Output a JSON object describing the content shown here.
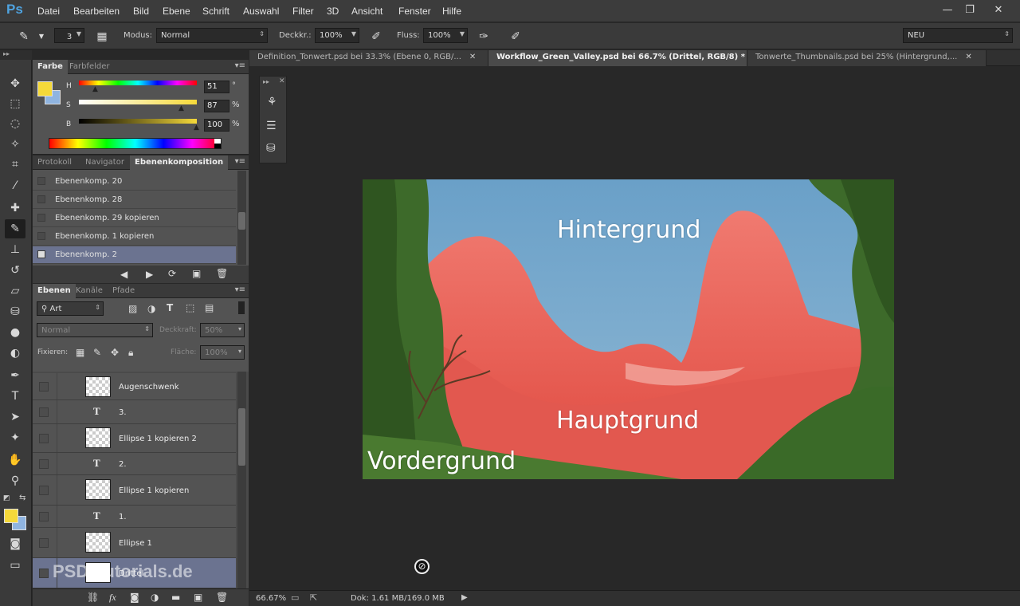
{
  "app": {
    "logo": "Ps"
  },
  "menu": [
    "Datei",
    "Bearbeiten",
    "Bild",
    "Ebene",
    "Schrift",
    "Auswahl",
    "Filter",
    "3D",
    "Ansicht",
    "Fenster",
    "Hilfe"
  ],
  "window_controls": {
    "minimize": "—",
    "restore": "❐",
    "close": "✕"
  },
  "options": {
    "brush_size": "3",
    "mode_label": "Modus:",
    "mode_value": "Normal",
    "opacity_label": "Deckkr.:",
    "opacity_value": "100%",
    "flow_label": "Fluss:",
    "flow_value": "100%",
    "workspace": "NEU"
  },
  "color_panel": {
    "tabs": [
      "Farbe",
      "Farbfelder"
    ],
    "h_label": "H",
    "h_value": "51",
    "h_unit": "°",
    "s_label": "S",
    "s_value": "87",
    "s_unit": "%",
    "b_label": "B",
    "b_value": "100",
    "b_unit": "%",
    "foreground": "#f5d93a",
    "background": "#8fb4e0"
  },
  "comp_panel": {
    "tabs": [
      "Protokoll",
      "Navigator",
      "Ebenenkomposition"
    ],
    "items": [
      "Ebenenkomp. 20",
      "Ebenenkomp. 28",
      "Ebenenkomp. 29 kopieren",
      "Ebenenkomp. 1 kopieren",
      "Ebenenkomp. 2"
    ],
    "selected": 4
  },
  "layers_panel": {
    "tabs": [
      "Ebenen",
      "Kanäle",
      "Pfade"
    ],
    "filter_label": "Art",
    "blend_mode": "Normal",
    "opacity_label": "Deckkraft:",
    "opacity_value": "50%",
    "lock_label": "Fixieren:",
    "fill_label": "Fläche:",
    "fill_value": "100%",
    "layers": [
      {
        "name": "Augenschwenk",
        "kind": "pixel"
      },
      {
        "name": "3.",
        "kind": "text"
      },
      {
        "name": "Ellipse 1 kopieren 2",
        "kind": "shape"
      },
      {
        "name": "2.",
        "kind": "text"
      },
      {
        "name": "Ellipse 1 kopieren",
        "kind": "shape"
      },
      {
        "name": "1.",
        "kind": "text"
      },
      {
        "name": "Ellipse 1",
        "kind": "shape"
      },
      {
        "name": "Drittel",
        "kind": "shape"
      }
    ]
  },
  "doc_tabs": [
    {
      "title": "Definition_Tonwert.psd bei 33.3% (Ebene 0, RGB/...",
      "close": "✕"
    },
    {
      "title": "Workflow_Green_Valley.psd bei 66.7% (Drittel, RGB/8) *",
      "close": "✕"
    },
    {
      "title": "Tonwerte_Thumbnails.psd bei 25% (Hintergrund,...",
      "close": "✕"
    }
  ],
  "artwork_labels": {
    "top": "Hintergrund",
    "middle": "Hauptgrund",
    "bottom": "Vordergrund"
  },
  "status": {
    "zoom": "66.67%",
    "doc": "Dok: 1.61 MB/169.0 MB"
  },
  "watermark": "PSD-Tutorials.de",
  "colors": {
    "accent_selected": "#6b7390",
    "sky": "#6aa0c8",
    "mountain_red": "#e2584f",
    "forest": "#3d6a2a"
  }
}
